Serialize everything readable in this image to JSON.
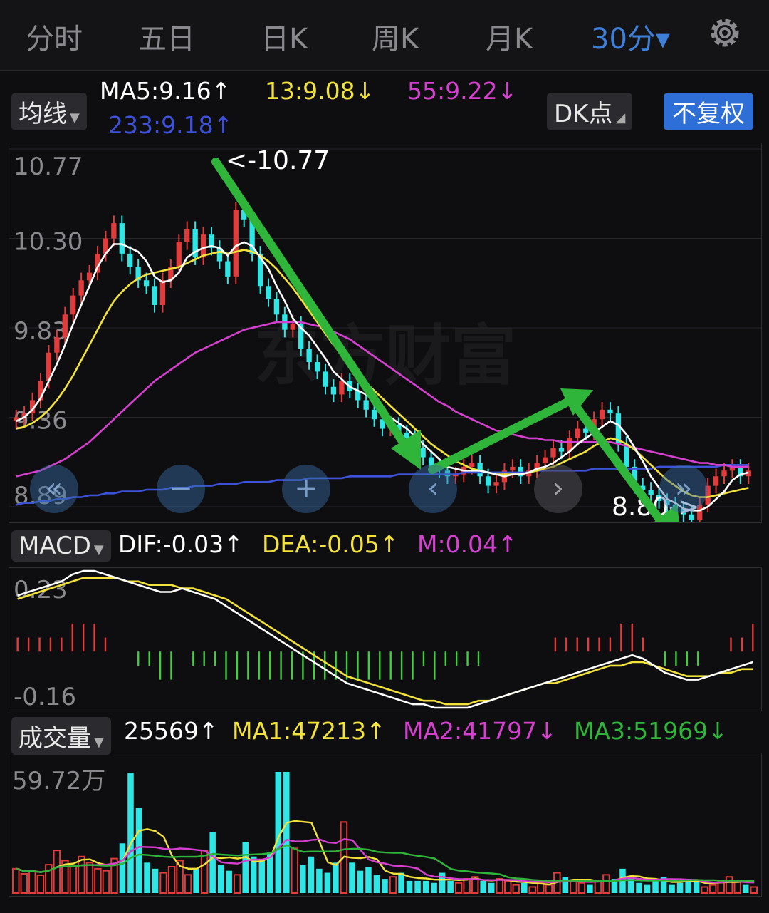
{
  "tabs": [
    {
      "label": "分时",
      "active": false
    },
    {
      "label": "五日",
      "active": false
    },
    {
      "label": "日K",
      "active": false
    },
    {
      "label": "周K",
      "active": false
    },
    {
      "label": "月K",
      "active": false
    },
    {
      "label": "30分▾",
      "active": true
    }
  ],
  "icons": {
    "settings": "gear-icon"
  },
  "ma_bar": {
    "selector": "均线",
    "ma5": "MA5:9.16↑",
    "ma13": "13:9.08↓",
    "ma55": "55:9.22↓",
    "ma233": "233:9.18↑",
    "dk_button": "DK点",
    "fq_button": "不复权"
  },
  "price_panel": {
    "ticks": [
      "10.77",
      "10.30",
      "9.83",
      "9.36",
      "8.89"
    ],
    "high_marker": "<-10.77",
    "low_marker": "8.80->",
    "watermark": "东方财富"
  },
  "macd_bar": {
    "selector": "MACD",
    "dif": "DIF:-0.03↑",
    "dea": "DEA:-0.05↑",
    "m": "M:0.04↑"
  },
  "macd_panel": {
    "ticks": [
      "0.23",
      "-0.16"
    ]
  },
  "vol_bar": {
    "selector": "成交量",
    "value": "25569↑",
    "ma1": "MA1:47213↑",
    "ma2": "MA2:41797↓",
    "ma3": "MA3:51969↓"
  },
  "vol_panel": {
    "ticks": [
      "59.72万"
    ]
  },
  "colors": {
    "up": "#e23b3b",
    "down": "#2ee6e6",
    "ma5": "#ffffff",
    "ma13": "#f2e23a",
    "ma55": "#d63fd0",
    "ma233": "#3d52d9",
    "accent": "#3d7fd9",
    "arrow": "#2fb53a"
  },
  "chart_data": {
    "type": "candlestick",
    "price_range": [
      8.89,
      10.77
    ],
    "closes": [
      9.36,
      9.38,
      9.45,
      9.55,
      9.7,
      9.78,
      9.9,
      10.0,
      10.08,
      10.12,
      10.22,
      10.3,
      10.38,
      10.22,
      10.15,
      10.08,
      10.05,
      9.95,
      10.08,
      10.15,
      10.28,
      10.35,
      10.2,
      10.32,
      10.25,
      10.18,
      10.1,
      10.45,
      10.4,
      10.22,
      10.05,
      9.98,
      9.9,
      9.82,
      9.85,
      9.72,
      9.65,
      9.6,
      9.52,
      9.48,
      9.55,
      9.5,
      9.45,
      9.4,
      9.35,
      9.3,
      9.32,
      9.28,
      9.25,
      9.2,
      9.15,
      9.1,
      9.08,
      9.05,
      9.06,
      9.1,
      9.12,
      9.05,
      9.0,
      9.02,
      9.08,
      9.1,
      9.05,
      9.08,
      9.12,
      9.15,
      9.2,
      9.18,
      9.25,
      9.3,
      9.28,
      9.35,
      9.4,
      9.38,
      9.22,
      9.1,
      9.0,
      8.98,
      8.95,
      8.92,
      8.9,
      8.88,
      8.85,
      8.82,
      8.9,
      9.0,
      9.05,
      9.08,
      9.1,
      9.05,
      9.08
    ],
    "ma5": [
      9.34,
      9.36,
      9.4,
      9.46,
      9.55,
      9.64,
      9.74,
      9.85,
      9.95,
      10.05,
      10.15,
      10.22,
      10.27,
      10.27,
      10.25,
      10.23,
      10.18,
      10.1,
      10.07,
      10.08,
      10.12,
      10.2,
      10.23,
      10.25,
      10.26,
      10.25,
      10.21,
      10.26,
      10.28,
      10.26,
      10.2,
      10.14,
      10.05,
      9.97,
      9.88,
      9.83,
      9.79,
      9.73,
      9.67,
      9.6,
      9.56,
      9.52,
      9.5,
      9.48,
      9.45,
      9.4,
      9.36,
      9.33,
      9.3,
      9.26,
      9.22,
      9.18,
      9.14,
      9.1,
      9.09,
      9.08,
      9.08,
      9.08,
      9.07,
      9.06,
      9.05,
      9.06,
      9.06,
      9.07,
      9.09,
      9.1,
      9.12,
      9.15,
      9.18,
      9.22,
      9.25,
      9.28,
      9.31,
      9.34,
      9.32,
      9.27,
      9.2,
      9.13,
      9.05,
      8.99,
      8.93,
      8.91,
      8.88,
      8.87,
      8.87,
      8.89,
      8.93,
      8.97,
      9.03,
      9.06,
      9.07
    ],
    "ma13": [
      9.3,
      9.31,
      9.33,
      9.36,
      9.4,
      9.45,
      9.51,
      9.58,
      9.66,
      9.74,
      9.82,
      9.9,
      9.97,
      10.02,
      10.06,
      10.09,
      10.11,
      10.12,
      10.13,
      10.14,
      10.15,
      10.17,
      10.19,
      10.21,
      10.22,
      10.23,
      10.22,
      10.23,
      10.24,
      10.23,
      10.21,
      10.18,
      10.14,
      10.09,
      10.04,
      9.98,
      9.92,
      9.86,
      9.8,
      9.74,
      9.69,
      9.64,
      9.59,
      9.54,
      9.5,
      9.46,
      9.42,
      9.38,
      9.34,
      9.3,
      9.26,
      9.22,
      9.19,
      9.16,
      9.13,
      9.11,
      9.09,
      9.08,
      9.07,
      9.06,
      9.06,
      9.06,
      9.06,
      9.07,
      9.08,
      9.09,
      9.1,
      9.12,
      9.14,
      9.16,
      9.18,
      9.21,
      9.23,
      9.25,
      9.24,
      9.22,
      9.19,
      9.15,
      9.11,
      9.07,
      9.03,
      9.0,
      8.97,
      8.95,
      8.94,
      8.94,
      8.95,
      8.96,
      8.97,
      8.98,
      8.99
    ],
    "ma55": [
      9.05,
      9.06,
      9.07,
      9.08,
      9.1,
      9.12,
      9.14,
      9.17,
      9.2,
      9.23,
      9.27,
      9.31,
      9.35,
      9.39,
      9.43,
      9.47,
      9.51,
      9.55,
      9.58,
      9.61,
      9.64,
      9.67,
      9.7,
      9.72,
      9.74,
      9.76,
      9.78,
      9.8,
      9.82,
      9.83,
      9.84,
      9.85,
      9.86,
      9.86,
      9.86,
      9.86,
      9.85,
      9.84,
      9.83,
      9.81,
      9.79,
      9.77,
      9.74,
      9.71,
      9.68,
      9.65,
      9.62,
      9.59,
      9.56,
      9.53,
      9.5,
      9.47,
      9.44,
      9.42,
      9.39,
      9.37,
      9.35,
      9.33,
      9.31,
      9.29,
      9.28,
      9.27,
      9.26,
      9.25,
      9.25,
      9.24,
      9.24,
      9.23,
      9.23,
      9.23,
      9.23,
      9.23,
      9.23,
      9.23,
      9.22,
      9.21,
      9.2,
      9.19,
      9.18,
      9.17,
      9.16,
      9.15,
      9.14,
      9.13,
      9.12,
      9.12,
      9.11,
      9.11,
      9.1,
      9.1,
      9.1
    ],
    "ma233": [
      8.9,
      8.91,
      8.91,
      8.92,
      8.92,
      8.93,
      8.93,
      8.94,
      8.94,
      8.95,
      8.95,
      8.96,
      8.96,
      8.97,
      8.97,
      8.97,
      8.98,
      8.98,
      8.98,
      8.99,
      8.99,
      8.99,
      9.0,
      9.0,
      9.0,
      9.01,
      9.01,
      9.01,
      9.02,
      9.02,
      9.02,
      9.02,
      9.03,
      9.03,
      9.03,
      9.03,
      9.04,
      9.04,
      9.04,
      9.04,
      9.04,
      9.05,
      9.05,
      9.05,
      9.05,
      9.05,
      9.05,
      9.06,
      9.06,
      9.06,
      9.06,
      9.06,
      9.06,
      9.06,
      9.06,
      9.07,
      9.07,
      9.07,
      9.07,
      9.07,
      9.07,
      9.07,
      9.07,
      9.07,
      9.08,
      9.08,
      9.08,
      9.08,
      9.08,
      9.08,
      9.08,
      9.09,
      9.09,
      9.09,
      9.09,
      9.09,
      9.09,
      9.09,
      9.09,
      9.1,
      9.1,
      9.1,
      9.1,
      9.1,
      9.1,
      9.1,
      9.1,
      9.11,
      9.11,
      9.11,
      9.11
    ],
    "macd_range": [
      -0.16,
      0.23
    ],
    "dif": [
      0.16,
      0.17,
      0.18,
      0.19,
      0.2,
      0.22,
      0.23,
      0.23,
      0.22,
      0.21,
      0.2,
      0.19,
      0.18,
      0.17,
      0.17,
      0.18,
      0.17,
      0.16,
      0.15,
      0.13,
      0.11,
      0.09,
      0.07,
      0.05,
      0.03,
      0.01,
      -0.01,
      -0.03,
      -0.05,
      -0.07,
      -0.09,
      -0.1,
      -0.11,
      -0.12,
      -0.13,
      -0.14,
      -0.15,
      -0.15,
      -0.16,
      -0.16,
      -0.16,
      -0.16,
      -0.15,
      -0.14,
      -0.13,
      -0.12,
      -0.11,
      -0.1,
      -0.09,
      -0.08,
      -0.07,
      -0.06,
      -0.05,
      -0.04,
      -0.03,
      -0.02,
      -0.01,
      -0.02,
      -0.04,
      -0.06,
      -0.07,
      -0.08,
      -0.08,
      -0.07,
      -0.06,
      -0.05,
      -0.04,
      -0.03
    ],
    "dea": [
      0.15,
      0.16,
      0.17,
      0.18,
      0.19,
      0.2,
      0.21,
      0.21,
      0.21,
      0.21,
      0.2,
      0.2,
      0.19,
      0.19,
      0.19,
      0.18,
      0.18,
      0.17,
      0.16,
      0.15,
      0.13,
      0.11,
      0.09,
      0.07,
      0.05,
      0.03,
      0.01,
      -0.01,
      -0.03,
      -0.05,
      -0.07,
      -0.08,
      -0.09,
      -0.1,
      -0.11,
      -0.12,
      -0.13,
      -0.14,
      -0.14,
      -0.15,
      -0.15,
      -0.15,
      -0.14,
      -0.14,
      -0.13,
      -0.12,
      -0.11,
      -0.1,
      -0.09,
      -0.09,
      -0.08,
      -0.07,
      -0.06,
      -0.05,
      -0.04,
      -0.04,
      -0.03,
      -0.03,
      -0.04,
      -0.05,
      -0.06,
      -0.07,
      -0.07,
      -0.07,
      -0.06,
      -0.06,
      -0.05,
      -0.05
    ],
    "vol_max": 597200,
    "volumes": [
      120000,
      95000,
      110000,
      88000,
      140000,
      210000,
      160000,
      130000,
      180000,
      150000,
      120000,
      110000,
      170000,
      245000,
      590000,
      420000,
      150000,
      120000,
      100000,
      130000,
      160000,
      90000,
      120000,
      210000,
      300000,
      140000,
      110000,
      90000,
      250000,
      180000,
      160000,
      200000,
      597200,
      597200,
      220000,
      140000,
      180000,
      120000,
      100000,
      150000,
      350000,
      150000,
      110000,
      130000,
      90000,
      70000,
      80000,
      100000,
      60000,
      60000,
      60000,
      50000,
      100000,
      60000,
      50000,
      70000,
      80000,
      60000,
      50000,
      70000,
      60000,
      40000,
      50000,
      30000,
      50000,
      40000,
      100000,
      80000,
      60000,
      50000,
      40000,
      60000,
      90000,
      70000,
      120000,
      80000,
      50000,
      40000,
      60000,
      80000,
      40000,
      50000,
      70000,
      60000,
      30000,
      40000,
      60000,
      80000,
      60000,
      40000,
      30000
    ]
  }
}
